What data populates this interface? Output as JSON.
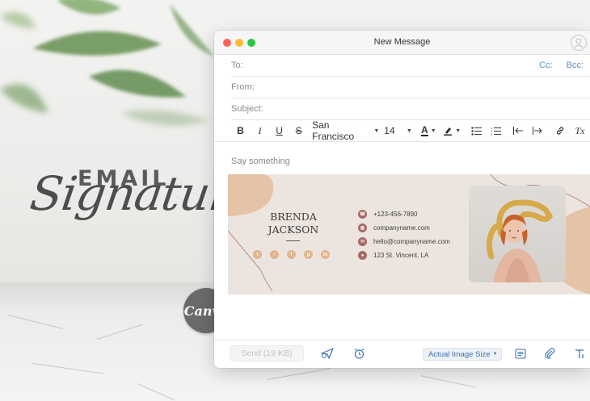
{
  "heading": {
    "line1": "EMAIL",
    "line2": "Signature",
    "badge": "Canva"
  },
  "window": {
    "title": "New Message",
    "fields": {
      "to_label": "To:",
      "from_label": "From:",
      "subject_label": "Subject:",
      "cc_label": "Cc:",
      "bcc_label": "Bcc:"
    },
    "toolbar": {
      "bold": "B",
      "italic": "I",
      "underline": "U",
      "strike": "S",
      "font": "San Francisco",
      "size": "14",
      "text_color": "A",
      "clear_format": "Tx"
    },
    "body_placeholder": "Say something",
    "send_label": "Send (19 KB)",
    "image_size_label": "Actual Image Size"
  },
  "signature": {
    "first_name": "BRENDA",
    "last_name": "JACKSON",
    "socials": [
      "twitter-icon",
      "instagram-icon",
      "facebook-icon",
      "pinterest-icon",
      "linkedin-icon"
    ],
    "contacts": [
      {
        "icon": "phone-icon",
        "text": "+123-456-7890"
      },
      {
        "icon": "web-icon",
        "text": "companyname.com"
      },
      {
        "icon": "mail-icon",
        "text": "hello@companyname.com"
      },
      {
        "icon": "location-icon",
        "text": "123 St. Vincent, LA"
      }
    ]
  },
  "colors": {
    "accent_link": "#5d8dc2",
    "signature_bg": "#ece5df",
    "signature_peach": "#e2b58e",
    "signature_icon": "#a76a67"
  }
}
